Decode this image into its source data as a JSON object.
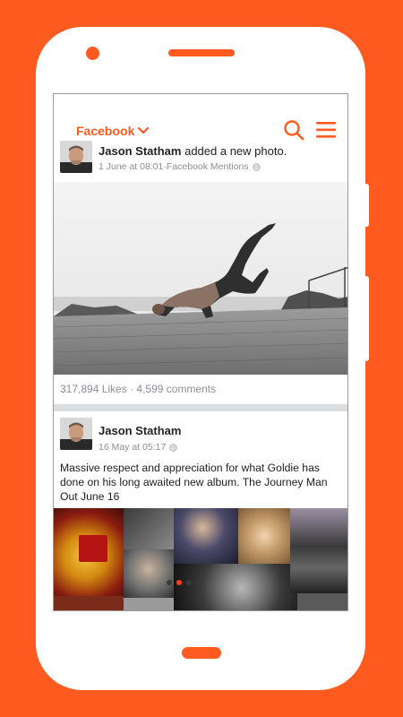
{
  "header": {
    "feed_selector": "Facebook",
    "accent": "#ff5a1f"
  },
  "posts": [
    {
      "author": "Jason Statham",
      "action": " added a new photo.",
      "date": "1 June at 08:01",
      "separator": " · ",
      "source": "Facebook Mentions",
      "privacy_icon": "globe-icon",
      "likes": "317,894 Likes",
      "stats_separator": " · ",
      "comments": "4,599 comments"
    },
    {
      "author": "Jason Statham",
      "date": "16 May at 05:17",
      "privacy_icon": "globe-icon",
      "text": "Massive respect and appreciation for what Goldie has done on his long awaited new album. The Journey Man Out June 16"
    }
  ],
  "carousel": {
    "slide_count": 3,
    "active_index": 0
  },
  "icons": [
    "chevron-down-icon",
    "search-icon",
    "hamburger-menu-icon",
    "globe-icon"
  ]
}
